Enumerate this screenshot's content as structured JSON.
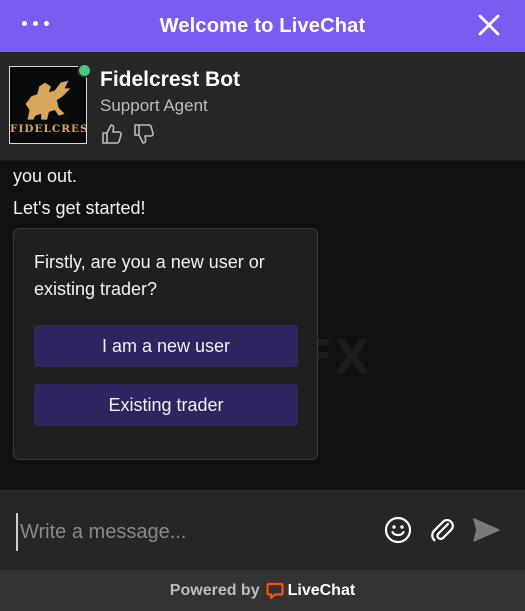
{
  "header": {
    "title": "Welcome to LiveChat",
    "bg_color": "#7a5cf0",
    "menu_icon": "more-dots-icon",
    "close_icon": "close-icon"
  },
  "agent": {
    "name": "Fidelcrest Bot",
    "role": "Support Agent",
    "logo_text": "FIDELCREST",
    "status": "online",
    "status_color": "#48c97a"
  },
  "messages": [
    {
      "text": "you out."
    },
    {
      "text": "Let's get started!"
    }
  ],
  "quick_reply": {
    "question": "Firstly, are you a new user or existing trader?",
    "options": [
      {
        "label": "I am a new user"
      },
      {
        "label": "Existing trader"
      }
    ]
  },
  "composer": {
    "placeholder": "Write a message..."
  },
  "footer": {
    "powered_by": "Powered by",
    "brand": "LiveChat",
    "brand_color": "#ff5100"
  },
  "watermark": {
    "text": "WikiFX"
  }
}
